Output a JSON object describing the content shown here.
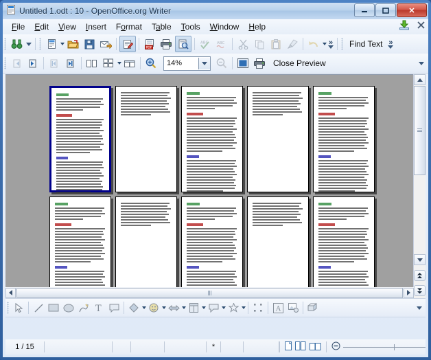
{
  "window": {
    "title": "Untitled 1.odt : 10 - OpenOffice.org Writer",
    "app_icon": "writer-document-icon",
    "controls": {
      "minimize": "–",
      "maximize": "❐",
      "close": "✕"
    }
  },
  "menubar": {
    "items": [
      {
        "label": "File",
        "accel": "F"
      },
      {
        "label": "Edit",
        "accel": "E"
      },
      {
        "label": "View",
        "accel": "V"
      },
      {
        "label": "Insert",
        "accel": "I"
      },
      {
        "label": "Format",
        "accel": "o"
      },
      {
        "label": "Table",
        "accel": "a"
      },
      {
        "label": "Tools",
        "accel": "T"
      },
      {
        "label": "Window",
        "accel": "W"
      },
      {
        "label": "Help",
        "accel": "H"
      }
    ],
    "right_icons": [
      "download-arrow-icon",
      "close-document-icon"
    ]
  },
  "toolbar_standard": {
    "buttons": [
      {
        "name": "find-replace-binoculars",
        "state": "enabled"
      },
      {
        "name": "new-document",
        "state": "enabled",
        "dropdown": true
      },
      {
        "name": "open-folder",
        "state": "enabled"
      },
      {
        "name": "save",
        "state": "enabled"
      },
      {
        "name": "email-document",
        "state": "enabled"
      },
      {
        "name": "edit-file",
        "state": "pressed"
      },
      {
        "name": "export-pdf",
        "state": "enabled"
      },
      {
        "name": "print",
        "state": "enabled"
      },
      {
        "name": "print-preview",
        "state": "pressed"
      },
      {
        "name": "spelling",
        "state": "disabled"
      },
      {
        "name": "autospellcheck",
        "state": "disabled"
      },
      {
        "name": "cut",
        "state": "disabled"
      },
      {
        "name": "copy",
        "state": "disabled"
      },
      {
        "name": "paste",
        "state": "disabled"
      },
      {
        "name": "clone-formatting",
        "state": "disabled"
      },
      {
        "name": "undo",
        "state": "disabled",
        "dropdown": true
      }
    ],
    "overflow": "»",
    "find_text_label": "Find Text",
    "find_overflow": "»"
  },
  "toolbar_preview": {
    "buttons": [
      {
        "name": "previous-page",
        "state": "disabled"
      },
      {
        "name": "next-page",
        "state": "enabled"
      },
      {
        "name": "first-page",
        "state": "disabled"
      },
      {
        "name": "last-page",
        "state": "enabled"
      },
      {
        "name": "two-pages-preview",
        "state": "enabled"
      },
      {
        "name": "multiple-pages-preview",
        "state": "enabled",
        "dropdown": true
      },
      {
        "name": "book-preview",
        "state": "enabled"
      },
      {
        "name": "zoom-in",
        "state": "enabled"
      },
      {
        "name": "zoom-out",
        "state": "disabled"
      },
      {
        "name": "full-screen",
        "state": "enabled"
      },
      {
        "name": "print-document",
        "state": "enabled"
      }
    ],
    "zoom_value": "14%",
    "close_preview_label": "Close Preview"
  },
  "preview": {
    "columns": 5,
    "rows": 2,
    "selected_page": 1,
    "pages": [
      {
        "number": 1,
        "selected": true,
        "layout": "content"
      },
      {
        "number": 2,
        "selected": false,
        "layout": "short"
      },
      {
        "number": 3,
        "selected": false,
        "layout": "content"
      },
      {
        "number": 4,
        "selected": false,
        "layout": "short"
      },
      {
        "number": 5,
        "selected": false,
        "layout": "content"
      },
      {
        "number": 6,
        "selected": false,
        "layout": "content"
      },
      {
        "number": 7,
        "selected": false,
        "layout": "short"
      },
      {
        "number": 8,
        "selected": false,
        "layout": "content"
      },
      {
        "number": 9,
        "selected": false,
        "layout": "short"
      },
      {
        "number": 10,
        "selected": false,
        "layout": "content"
      }
    ],
    "heading_colors": {
      "green": "#2e8b3d",
      "red": "#b32020",
      "blue": "#2a2ab0"
    },
    "canvas_color": "#a0a0a0",
    "selection_color": "#00008b"
  },
  "drawbar": {
    "buttons": [
      {
        "name": "select-arrow"
      },
      {
        "name": "line"
      },
      {
        "name": "rectangle"
      },
      {
        "name": "ellipse"
      },
      {
        "name": "freeform-line"
      },
      {
        "name": "text-box"
      },
      {
        "name": "callout"
      },
      {
        "name": "basic-shapes",
        "dropdown": true
      },
      {
        "name": "symbol-shapes",
        "dropdown": true
      },
      {
        "name": "block-arrows",
        "dropdown": true
      },
      {
        "name": "flowchart",
        "dropdown": true
      },
      {
        "name": "callout-shapes",
        "dropdown": true
      },
      {
        "name": "stars",
        "dropdown": true
      },
      {
        "name": "points"
      },
      {
        "name": "fontwork-gallery"
      },
      {
        "name": "from-file"
      },
      {
        "name": "extrusion-on-off"
      }
    ]
  },
  "statusbar": {
    "page_indicator": "1 / 15",
    "modified_indicator": "*",
    "view_layout_icons": [
      "single-page-view",
      "multi-page-view",
      "book-view"
    ],
    "zoom_minus": "⊖"
  }
}
